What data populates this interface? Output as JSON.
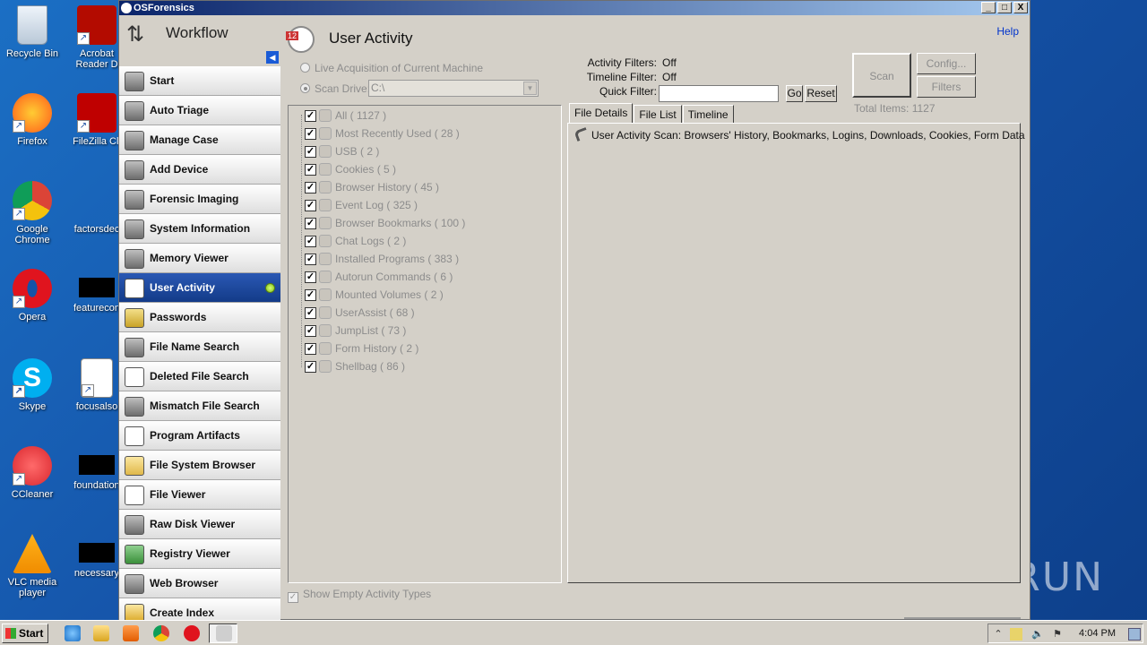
{
  "desktop": {
    "icons": [
      {
        "label": "Recycle Bin",
        "icon": "recycle-bin-icon",
        "color": "#dfe9f3"
      },
      {
        "label": "Acrobat Reader D",
        "icon": "acrobat-icon",
        "color": "#b30b00"
      },
      {
        "label": "Firefox",
        "icon": "firefox-icon",
        "color": "#ff7a1a"
      },
      {
        "label": "FileZilla Cli",
        "icon": "filezilla-icon",
        "color": "#bf0000"
      },
      {
        "label": "Google Chrome",
        "icon": "chrome-icon",
        "color": "#3b8a3b"
      },
      {
        "label": "factorsdec",
        "icon": "file-icon",
        "color": ""
      },
      {
        "label": "Opera",
        "icon": "opera-icon",
        "color": "#e0141e"
      },
      {
        "label": "featurecon",
        "icon": "black-file-icon",
        "color": "#000000"
      },
      {
        "label": "Skype",
        "icon": "skype-icon",
        "color": "#00aff0"
      },
      {
        "label": "focusalso",
        "icon": "word-doc-icon",
        "color": "#2b5797"
      },
      {
        "label": "CCleaner",
        "icon": "ccleaner-icon",
        "color": "#d9272e"
      },
      {
        "label": "foundation",
        "icon": "black-file-icon",
        "color": "#000000"
      },
      {
        "label": "VLC media player",
        "icon": "vlc-icon",
        "color": "#f08c00"
      },
      {
        "label": "necessary",
        "icon": "black-file-icon",
        "color": "#000000"
      }
    ],
    "watermark": "ANY RUN"
  },
  "window": {
    "title": "OSForensics",
    "buttons": {
      "minimize": "_",
      "maximize": "□",
      "close": "X"
    }
  },
  "sidebar": {
    "title": "Workflow",
    "items": [
      {
        "label": "Start",
        "icon": "start-icon"
      },
      {
        "label": "Auto Triage",
        "icon": "fingerprint-icon"
      },
      {
        "label": "Manage Case",
        "icon": "briefcase-icon"
      },
      {
        "label": "Add Device",
        "icon": "disk-icon"
      },
      {
        "label": "Forensic Imaging",
        "icon": "drive-plus-icon"
      },
      {
        "label": "System Information",
        "icon": "computer-icon"
      },
      {
        "label": "Memory Viewer",
        "icon": "memory-icon"
      },
      {
        "label": "User Activity",
        "icon": "calendar-clock-icon",
        "active": true
      },
      {
        "label": "Passwords",
        "icon": "lock-icon"
      },
      {
        "label": "File Name Search",
        "icon": "binoculars-icon"
      },
      {
        "label": "Deleted File Search",
        "icon": "deleted-file-icon"
      },
      {
        "label": "Mismatch File Search",
        "icon": "abc-icon"
      },
      {
        "label": "Program Artifacts",
        "icon": "artifacts-icon"
      },
      {
        "label": "File System Browser",
        "icon": "folder-search-icon"
      },
      {
        "label": "File Viewer",
        "icon": "file-viewer-icon"
      },
      {
        "label": "Raw Disk Viewer",
        "icon": "raw-disk-icon"
      },
      {
        "label": "Registry Viewer",
        "icon": "registry-icon"
      },
      {
        "label": "Web Browser",
        "icon": "web-icon"
      },
      {
        "label": "Create Index",
        "icon": "index-icon"
      }
    ]
  },
  "main": {
    "title": "User Activity",
    "help": "Help",
    "live_acquisition": "Live Acquisition of Current Machine",
    "scan_drive_label": "Scan Drive:",
    "scan_drive_value": "C:\\",
    "filters": {
      "activity_label": "Activity Filters:",
      "activity_value": "Off",
      "timeline_label": "Timeline Filter:",
      "timeline_value": "Off",
      "quick_label": "Quick Filter:",
      "quick_value": "",
      "go": "Go",
      "reset": "Reset"
    },
    "scan_button": "Scan",
    "config_button": "Config...",
    "filters_button": "Filters",
    "total_items": "Total Items: 1127",
    "tree": [
      {
        "label": "All ( 1127 )"
      },
      {
        "label": "Most Recently Used ( 28 )"
      },
      {
        "label": "USB ( 2 )"
      },
      {
        "label": "Cookies ( 5 )"
      },
      {
        "label": "Browser History ( 45 )"
      },
      {
        "label": "Event Log ( 325 )"
      },
      {
        "label": "Browser Bookmarks ( 100 )"
      },
      {
        "label": "Chat Logs ( 2 )"
      },
      {
        "label": "Installed Programs ( 383 )"
      },
      {
        "label": "Autorun Commands ( 6 )"
      },
      {
        "label": "Mounted Volumes ( 2 )"
      },
      {
        "label": "UserAssist ( 68 )"
      },
      {
        "label": "JumpList ( 73 )"
      },
      {
        "label": "Form History ( 2 )"
      },
      {
        "label": "Shellbag ( 86 )"
      }
    ],
    "tabs": [
      "File Details",
      "File List",
      "Timeline"
    ],
    "details_text": "User Activity Scan: Browsers' History, Bookmarks, Logins, Downloads, Cookies, Form Data",
    "show_empty": "Show Empty Activity Types"
  },
  "taskbar": {
    "start": "Start",
    "time": "4:04 PM"
  }
}
